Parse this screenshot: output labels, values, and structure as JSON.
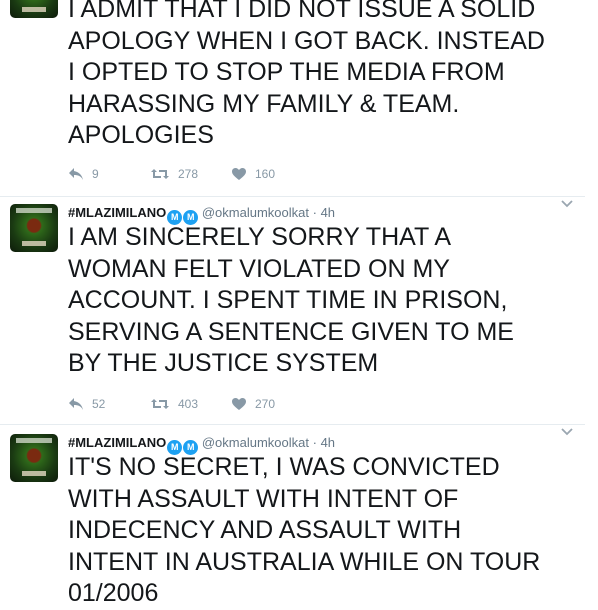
{
  "tweets": [
    {
      "text": "I ADMIT THAT I DID NOT ISSUE A SOLID\nAPOLOGY WHEN I GOT BACK. INSTEAD\nI OPTED TO STOP THE MEDIA FROM\nHARASSING MY FAMILY & TEAM.\nAPOLOGIES",
      "replies": "9",
      "retweets": "278",
      "likes": "160"
    },
    {
      "name": "#MLAZIMILANO",
      "badges": [
        "M",
        "M"
      ],
      "handle": "@okmalumkoolkat",
      "separator": "·",
      "time": "4h",
      "text": "I AM SINCERELY SORRY THAT A\nWOMAN FELT VIOLATED ON MY\nACCOUNT. I SPENT TIME IN PRISON,\nSERVING A SENTENCE GIVEN TO ME\nBY THE JUSTICE SYSTEM",
      "replies": "52",
      "retweets": "403",
      "likes": "270"
    },
    {
      "name": "#MLAZIMILANO",
      "badges": [
        "M",
        "M"
      ],
      "handle": "@okmalumkoolkat",
      "separator": "·",
      "time": "4h",
      "text": "IT'S NO SECRET, I WAS CONVICTED\nWITH ASSAULT WITH INTENT OF\nINDECENCY AND ASSAULT WITH\nINTENT IN AUSTRALIA WHILE ON TOUR\n01/2006"
    }
  ],
  "icons": {
    "reply": "reply-icon",
    "retweet": "retweet-icon",
    "like": "heart-icon",
    "caret": "chevron-down-icon",
    "verified": "verified-badge-icon"
  },
  "colors": {
    "text": "#14171a",
    "secondary": "#657786",
    "action": "#8899a6",
    "verified": "#1da1f2",
    "divider": "#e6ecf0"
  }
}
